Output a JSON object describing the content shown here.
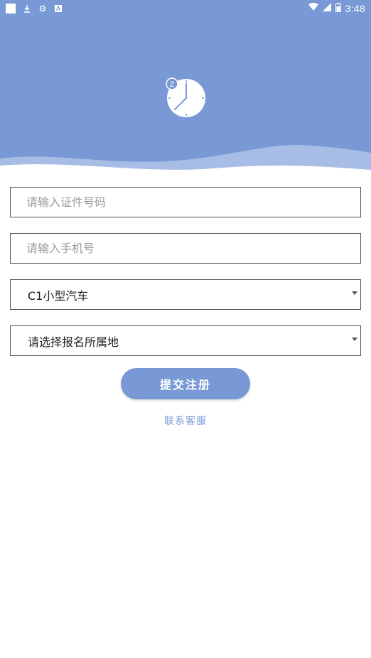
{
  "status_bar": {
    "time": "3:48",
    "left_icons": [
      "square-icon",
      "download-icon",
      "settings-icon",
      "app-icon"
    ],
    "right_icons": [
      "wifi-icon",
      "signal-icon",
      "battery-icon"
    ]
  },
  "header": {
    "badge_number": "2",
    "background_color": "#7899d6",
    "icon": "clock-icon"
  },
  "form": {
    "id_number": {
      "placeholder": "请输入证件号码",
      "value": ""
    },
    "phone": {
      "placeholder": "请输入手机号",
      "value": ""
    },
    "license_type": {
      "selected": "C1小型汽车"
    },
    "region": {
      "selected": "请选择报名所属地"
    }
  },
  "actions": {
    "submit_label": "提交注册",
    "contact_label": "联系客服"
  },
  "colors": {
    "accent": "#7899d6",
    "border": "#555555",
    "placeholder": "#9b9b9b"
  }
}
